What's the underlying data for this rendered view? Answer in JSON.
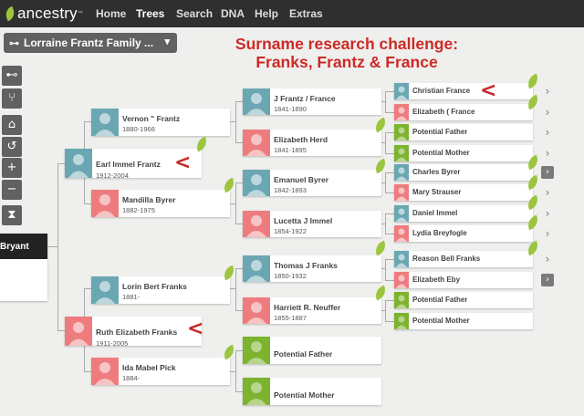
{
  "nav": {
    "logo": "ancestry",
    "items": [
      "Home",
      "Trees",
      "Search",
      "DNA",
      "Help",
      "Extras"
    ],
    "active": "Trees"
  },
  "tree_selector": {
    "label": "Lorraine Frantz Family ..."
  },
  "challenge": {
    "line1": "Surname research challenge:",
    "line2": "Franks, Frantz & France"
  },
  "tools": [
    "tree-view-icon",
    "family-view-icon",
    "home-icon",
    "refresh-icon",
    "zoom-in-icon",
    "zoom-out-icon",
    "hourglass-icon"
  ],
  "root_person": {
    "name": "Bryant"
  },
  "gen1": [
    {
      "name": "Earl Immel Frantz",
      "dates": "1912-2004",
      "gender": "male"
    },
    {
      "name": "Ruth Elizabeth Franks",
      "dates": "1911-2005",
      "gender": "female"
    }
  ],
  "gen2": [
    {
      "name": "Vernon \" Frantz",
      "dates": "1880-1966",
      "gender": "male"
    },
    {
      "name": "Mandilla Byrer",
      "dates": "1882-1975",
      "gender": "female"
    },
    {
      "name": "Lorin Bert Franks",
      "dates": "1881-",
      "gender": "male"
    },
    {
      "name": "Ida Mabel Pick",
      "dates": "1884-",
      "gender": "female"
    }
  ],
  "gen3": [
    {
      "name": "J Frantz / France",
      "dates": "1841-1890",
      "gender": "male"
    },
    {
      "name": "Elizabeth Herd",
      "dates": "1841-1895",
      "gender": "female"
    },
    {
      "name": "Emanuel Byrer",
      "dates": "1842-1893",
      "gender": "male"
    },
    {
      "name": "Lucetta J Immel",
      "dates": "1854-1922",
      "gender": "female"
    },
    {
      "name": "Thomas J Franks",
      "dates": "1850-1932",
      "gender": "male"
    },
    {
      "name": "Harriett R. Neuffer",
      "dates": "1855-1887",
      "gender": "female"
    },
    {
      "name": "Potential Father",
      "dates": "",
      "gender": "unknown"
    },
    {
      "name": "Potential Mother",
      "dates": "",
      "gender": "unknown"
    }
  ],
  "gen4": [
    {
      "name": "Christian France",
      "gender": "male"
    },
    {
      "name": "Elizabeth ( France",
      "gender": "female"
    },
    {
      "name": "Potential Father",
      "gender": "unknown"
    },
    {
      "name": "Potential Mother",
      "gender": "unknown"
    },
    {
      "name": "Charles Byrer",
      "gender": "male"
    },
    {
      "name": "Mary Strauser",
      "gender": "female"
    },
    {
      "name": "Daniel Immel",
      "gender": "male"
    },
    {
      "name": "Lydia Breyfogle",
      "gender": "female"
    },
    {
      "name": "Reason Bell Franks",
      "gender": "male"
    },
    {
      "name": "Elizabeth Eby",
      "gender": "female"
    },
    {
      "name": "Potential Father",
      "gender": "unknown"
    },
    {
      "name": "Potential Mother",
      "gender": "unknown"
    }
  ],
  "markers": [
    "<",
    "<",
    "<"
  ],
  "expand_glyph": "›",
  "colors": {
    "male": "#6aa7b3",
    "female": "#ee7c7f",
    "unknown": "#7cb32f",
    "hint": "#9bc53d",
    "marker": "#c62828",
    "challenge": "#cc2a27"
  }
}
